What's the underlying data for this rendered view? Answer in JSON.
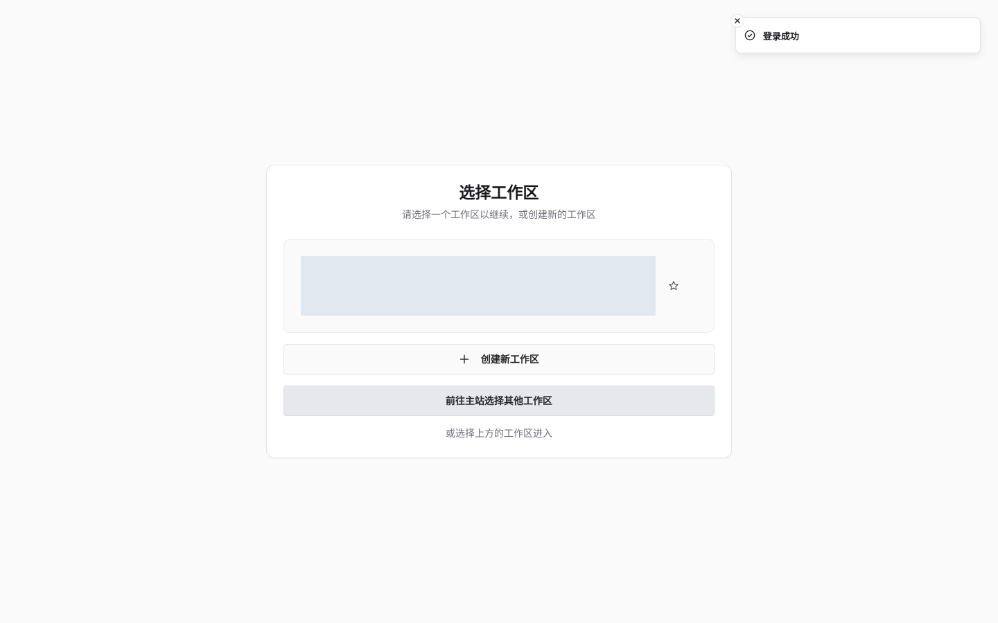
{
  "toast": {
    "message": "登录成功",
    "icon": "check-circle-icon",
    "close_icon": "close-icon"
  },
  "card": {
    "title": "选择工作区",
    "subtitle": "请选择一个工作区以继续，或创建新的工作区",
    "workspace_list": {
      "favorite_icon": "star-icon"
    },
    "create_button_label": "创建新工作区",
    "create_button_icon": "plus-icon",
    "main_site_button_label": "前往主站选择其他工作区",
    "hint": "或选择上方的工作区进入"
  },
  "colors": {
    "background": "#fafafa",
    "card": "#ffffff",
    "skeleton": "#e2e8f0",
    "muted_text": "#71717a",
    "secondary_button": "#e7e8ec"
  }
}
